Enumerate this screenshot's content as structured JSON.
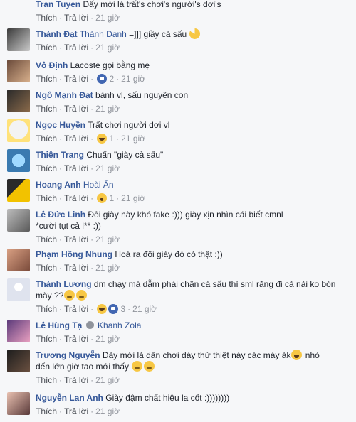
{
  "actions": {
    "like": "Thích",
    "reply": "Trả lời"
  },
  "comments": [
    {
      "author": "Tran Tuyen",
      "text": "Đấy mới là trất's chơi's người's dơi's",
      "time": "21 giờ"
    },
    {
      "author": "Thành Đạt",
      "tag": "Thành Danh",
      "text": " =]]] giầy cá sấu",
      "time": "21 giờ"
    },
    {
      "author": "Vô Định",
      "text": "Lacoste gọi bằng mẹ",
      "reaction_count": "2",
      "time": "21 giờ"
    },
    {
      "author": "Ngô Mạnh Đạt",
      "text": "bảnh vl, sấu nguyên con",
      "time": "21 giờ"
    },
    {
      "author": "Ngọc Huyền",
      "text": "Trất chơi người dơi vl",
      "reaction_count": "1",
      "time": "21 giờ"
    },
    {
      "author": "Thiên Trang",
      "text": "Chuẩn \"giày cả sấu\"",
      "time": "21 giờ"
    },
    {
      "author": "Hoang Anh",
      "tag": "Hoài Ân",
      "reaction_count": "1",
      "time": "21 giờ"
    },
    {
      "author": "Lê Đức Linh",
      "text": "Đôi giày này khó fake :))) giày xịn nhìn cái biết cmnl",
      "text2": "*cười tụt cả l** :))",
      "time": "21 giờ"
    },
    {
      "author": "Phạm Hồng Nhung",
      "text": "Hoá ra đôi giày đó có thật :))",
      "time": "21 giờ"
    },
    {
      "author": "Thành Lương",
      "text": "dm chạy mà dẫm phải chân cá sấu thì sml răng đi cả nải ko bòn",
      "text2": "mày ??",
      "reaction_count": "3",
      "time": "21 giờ"
    },
    {
      "author": "Lê Hùng Tạ",
      "tag": "Khanh Zola",
      "time": "21 giờ"
    },
    {
      "author": "Trương Nguyễn",
      "text": "Đây mới là dân chơi dày thứ thiệt này các mày àk",
      "text2a": " nhỏ",
      "text2": "đến lớn giờ tao mới thấy",
      "time": "21 giờ"
    },
    {
      "author": "Nguyễn Lan Anh",
      "text": "Giày đậm chất hiệu la cốt :))))))))",
      "time": "21 giờ"
    }
  ]
}
